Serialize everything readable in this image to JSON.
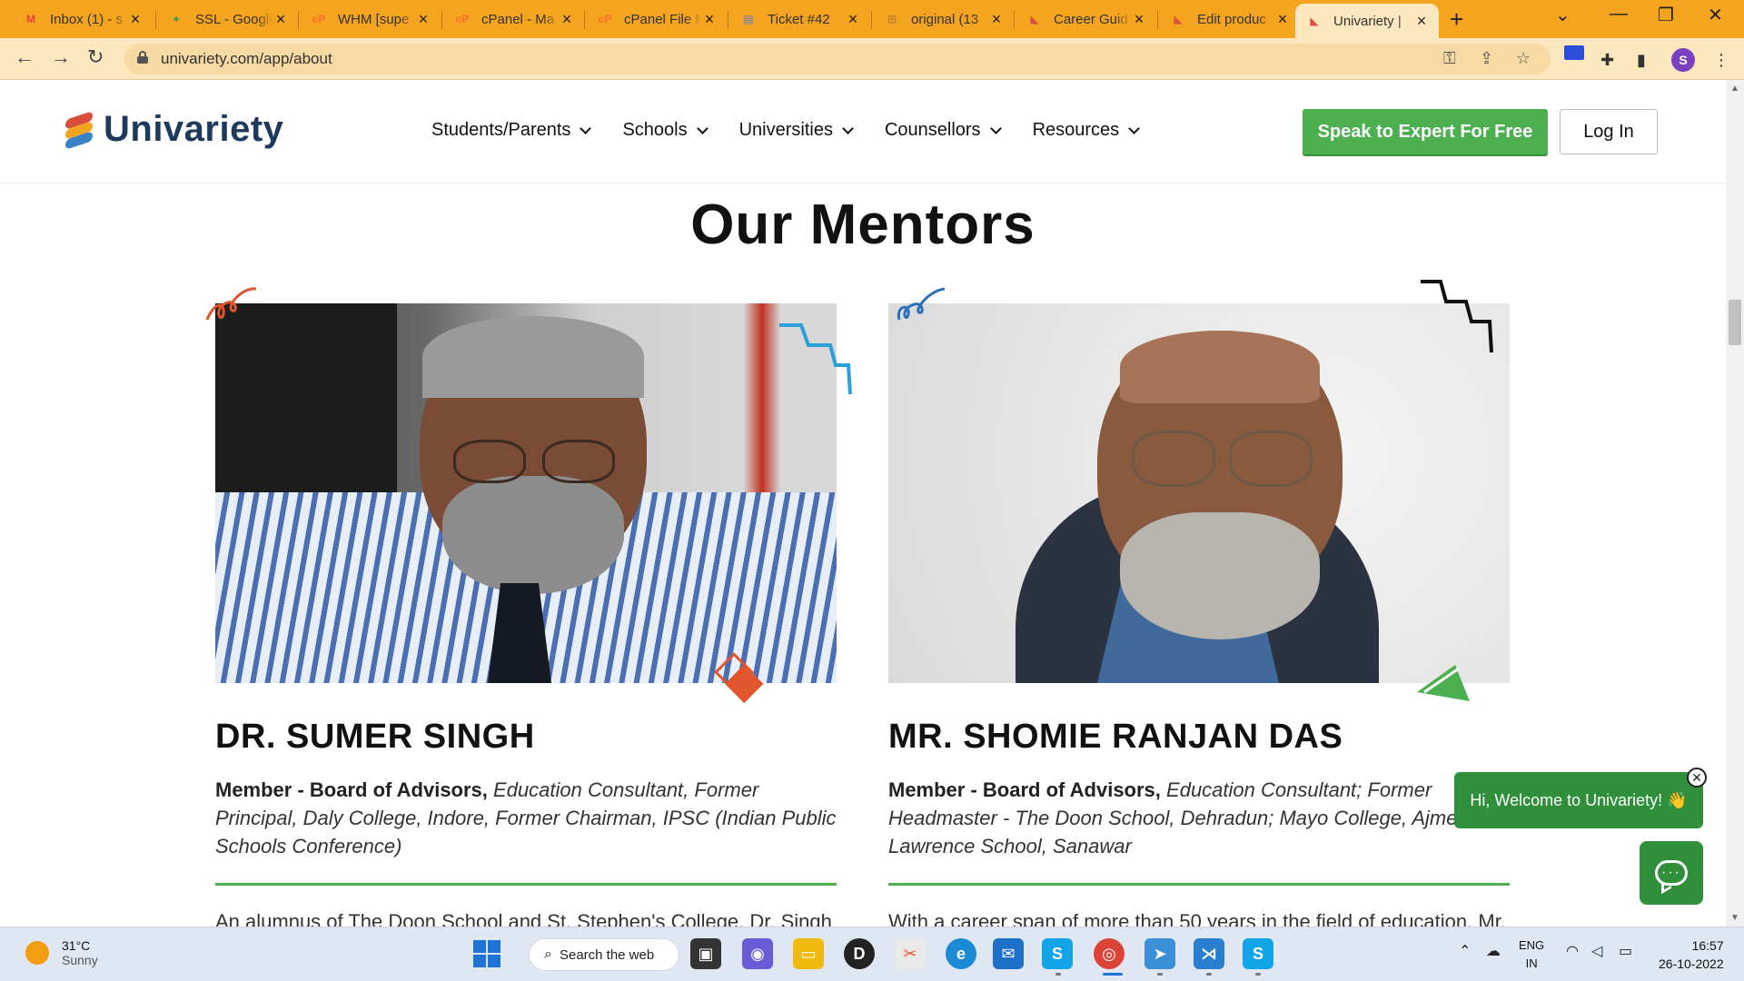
{
  "browser": {
    "tabs": [
      {
        "title": "Inbox (1) - s",
        "favicon": "gmail-icon",
        "color": "#ea4335",
        "glyph": "M"
      },
      {
        "title": "SSL - Google",
        "favicon": "sheets-icon",
        "color": "#0f9d58",
        "glyph": "+"
      },
      {
        "title": "WHM [supe",
        "favicon": "cpanel-icon",
        "color": "#ff6c2c",
        "glyph": "cP"
      },
      {
        "title": "cPanel - Ma",
        "favicon": "cpanel-icon",
        "color": "#ff6c2c",
        "glyph": "cP"
      },
      {
        "title": "cPanel File M",
        "favicon": "cpanel-icon",
        "color": "#ff6c2c",
        "glyph": "cP"
      },
      {
        "title": "Ticket #42",
        "favicon": "ticket-icon",
        "color": "#5b7bd5",
        "glyph": "▤"
      },
      {
        "title": "original (13",
        "favicon": "image-icon",
        "color": "#b9832e",
        "glyph": "⊞"
      },
      {
        "title": "Career Guid",
        "favicon": "univariety-icon",
        "color": "#d94f3d",
        "glyph": "◣"
      },
      {
        "title": "Edit produc",
        "favicon": "univariety-icon",
        "color": "#d94f3d",
        "glyph": "◣"
      },
      {
        "title": "Univariety |",
        "favicon": "univariety-icon",
        "color": "#d94f3d",
        "glyph": "◣",
        "active": true
      }
    ],
    "url": "univariety.com/app/about",
    "profile_initial": "S"
  },
  "site": {
    "logo_text": "Univariety",
    "nav": [
      {
        "label": "Students/Parents"
      },
      {
        "label": "Schools"
      },
      {
        "label": "Universities"
      },
      {
        "label": "Counsellors"
      },
      {
        "label": "Resources"
      }
    ],
    "cta_label": "Speak to Expert For Free",
    "login_label": "Log In",
    "colors": {
      "brand_green": "#4caf50",
      "brand_navy": "#1d3a5c",
      "chat_green": "#2f8f3a"
    }
  },
  "section": {
    "title": "Our Mentors"
  },
  "mentors": [
    {
      "name": "DR. SUMER SINGH",
      "role_bold": "Member - Board of Advisors,",
      "role_italic": "Education Consultant, Former Principal, Daly College, Indore, Former Chairman, IPSC (Indian Public Schools Conference)",
      "bio": "An alumnus of The Doon School and St. Stephen's College, Dr. Singh"
    },
    {
      "name": "MR. SHOMIE RANJAN DAS",
      "role_bold": "Member - Board of Advisors,",
      "role_italic": "Education Consultant; Former Headmaster - The Doon School, Dehradun; Mayo College, Ajmer, Lawrence School, Sanawar",
      "bio": "With a career span of more than 50 years in the field of education, Mr."
    }
  ],
  "chat": {
    "welcome": "Hi, Welcome to Univariety! 👋"
  },
  "taskbar": {
    "temperature": "31°C",
    "condition": "Sunny",
    "search_label": "Search the web",
    "lang_line1": "ENG",
    "lang_line2": "IN",
    "time": "16:57",
    "date": "26-10-2022"
  }
}
